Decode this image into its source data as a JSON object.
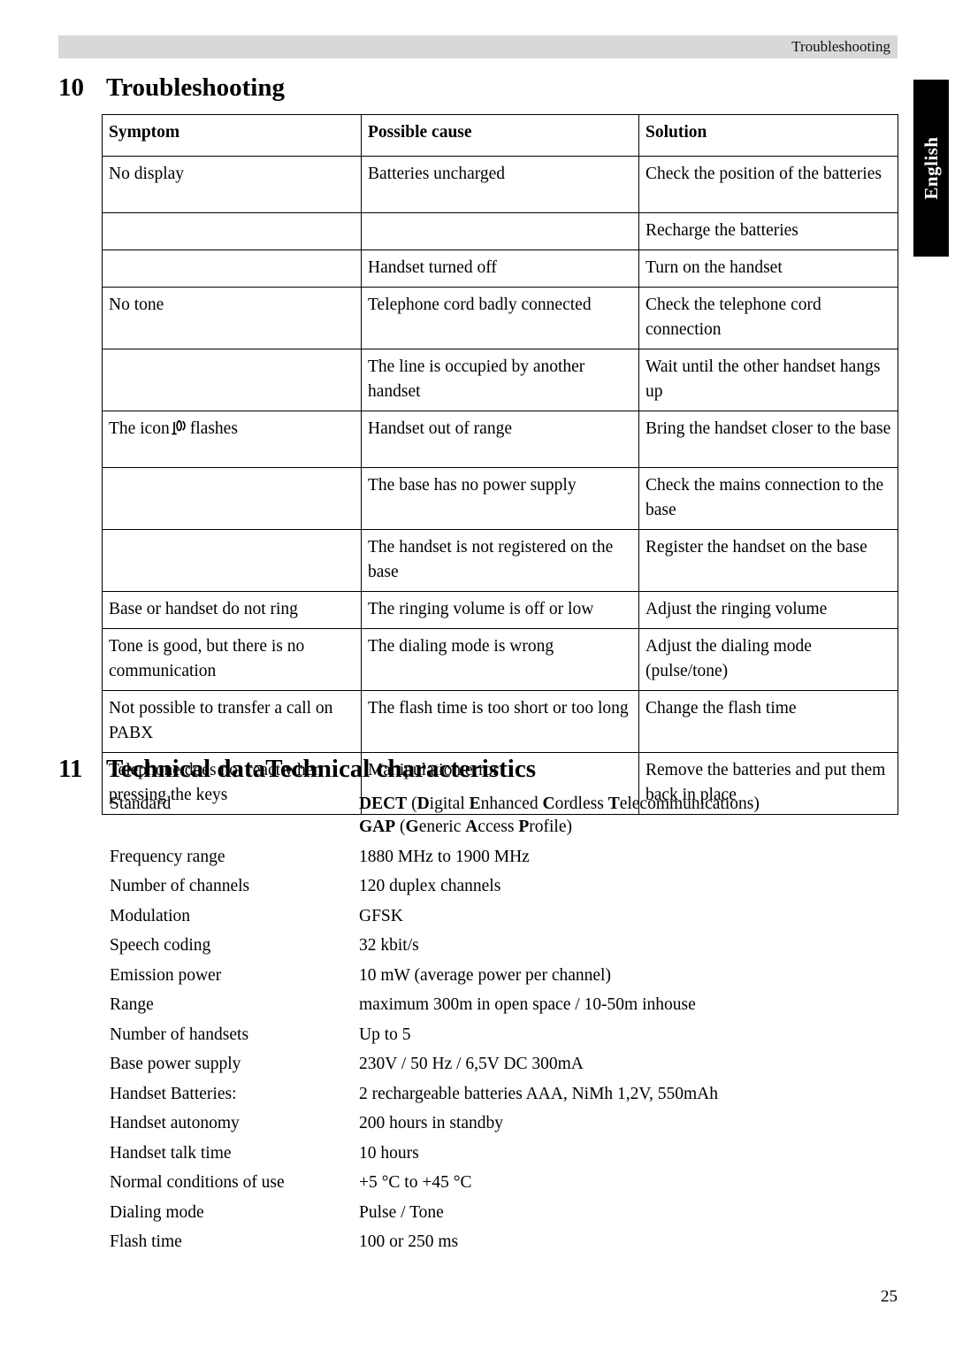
{
  "header": {
    "running_title": "Troubleshooting"
  },
  "language_tab": {
    "label": "English"
  },
  "sections": {
    "troubleshooting": {
      "number": "10",
      "title": "Troubleshooting"
    },
    "technical": {
      "number": "11",
      "title": "Technical dataTechnical characteristics"
    }
  },
  "troubleshooting_table": {
    "headers": [
      "Symptom",
      "Possible cause",
      "Solution"
    ],
    "rows": [
      {
        "symptom": "No display",
        "cause": "Batteries uncharged",
        "solution": "Check the position of the batteries"
      },
      {
        "symptom": "",
        "cause": "",
        "solution": "Recharge the batteries"
      },
      {
        "symptom": "",
        "cause": "Handset turned off",
        "solution": "Turn on the handset"
      },
      {
        "symptom": "No tone",
        "cause": "Telephone cord badly connected",
        "solution": "Check the telephone cord connection"
      },
      {
        "symptom": "",
        "cause": "The line is occupied by another handset",
        "solution": "Wait until the other handset hangs up"
      },
      {
        "symptom_prefix": "The icon",
        "symptom_icon": "antenna-signal-icon",
        "symptom_suffix": "flashes",
        "cause": "Handset out of range",
        "solution": "Bring the handset closer to the base"
      },
      {
        "symptom": "",
        "cause": "The base has no power supply",
        "solution": "Check the mains connection to the base"
      },
      {
        "symptom": "",
        "cause": "The handset is not registered on the base",
        "solution": "Register the handset on the base"
      },
      {
        "symptom": "Base or handset do not ring",
        "cause": "The ringing volume is off or low",
        "solution": "Adjust the ringing volume"
      },
      {
        "symptom": "Tone is good, but there is no communication",
        "cause": "The dialing mode is wrong",
        "solution": "Adjust the dialing mode (pulse/tone)"
      },
      {
        "symptom": "Not possible to transfer a call on PABX",
        "cause": "The flash time is too short or too long",
        "solution": "Change the flash time"
      },
      {
        "symptom": "Telephone does not react when pressing the keys",
        "cause": "Manipulation error",
        "solution": "Remove the batteries and put them back in place"
      }
    ]
  },
  "technical_specs": [
    {
      "label": "Standard",
      "value_line1_plain": "",
      "value_lines": [
        "DECT (Digital Enhanced Cordless Telecommunications)",
        "GAP (Generic Access Profile)"
      ]
    },
    {
      "label": "Frequency range",
      "value": "1880 MHz to 1900 MHz"
    },
    {
      "label": "Number of channels",
      "value": "120 duplex channels"
    },
    {
      "label": "Modulation",
      "value": "GFSK"
    },
    {
      "label": "Speech coding",
      "value": "32 kbit/s"
    },
    {
      "label": "Emission power",
      "value": "10 mW (average power per channel)"
    },
    {
      "label": "Range",
      "value": "maximum 300m in open space / 10-50m inhouse"
    },
    {
      "label": "Number of handsets",
      "value": "Up to 5"
    },
    {
      "label": "Base power supply",
      "value": "230V / 50 Hz / 6,5V DC 300mA"
    },
    {
      "label": "Handset Batteries:",
      "value": "2 rechargeable batteries AAA, NiMh 1,2V, 550mAh"
    },
    {
      "label": "Handset autonomy",
      "value": "200 hours in standby"
    },
    {
      "label": "Handset talk time",
      "value": "10 hours"
    },
    {
      "label": "Normal conditions of use",
      "value": "+5 °C to +45 °C"
    },
    {
      "label": "Dialing mode",
      "value": "Pulse / Tone"
    },
    {
      "label": "Flash time",
      "value": "100 or 250 ms"
    }
  ],
  "footer": {
    "page_number": "25"
  },
  "colors": {
    "header_band": "#d8d8d8",
    "tab_background": "#000000",
    "tab_text": "#ffffff",
    "text": "#000000"
  }
}
